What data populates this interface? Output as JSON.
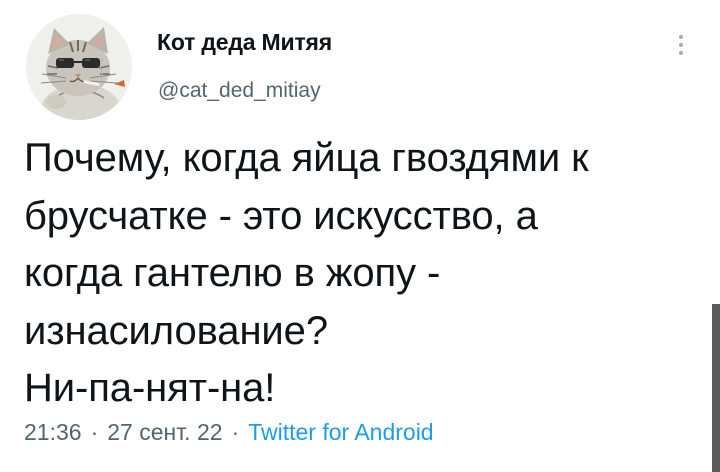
{
  "author": {
    "display_name": "Кот деда Митяя",
    "handle": "@cat_ded_mitiay",
    "avatar": "cat-avatar"
  },
  "more_icon": "more-vertical-icon",
  "tweet": {
    "lines": [
      "Почему, когда яйца гвоздями к",
      "брусчатке - это искусство, а",
      "когда гантелю в жопу -",
      "изнасилование?",
      "Ни-па-нят-на!"
    ]
  },
  "meta": {
    "time": "21:36",
    "date": "27 сент. 22",
    "separator": "·",
    "source": "Twitter for Android"
  },
  "colors": {
    "text": "#0f1419",
    "secondary": "#536471",
    "link": "#1d9bf0"
  }
}
